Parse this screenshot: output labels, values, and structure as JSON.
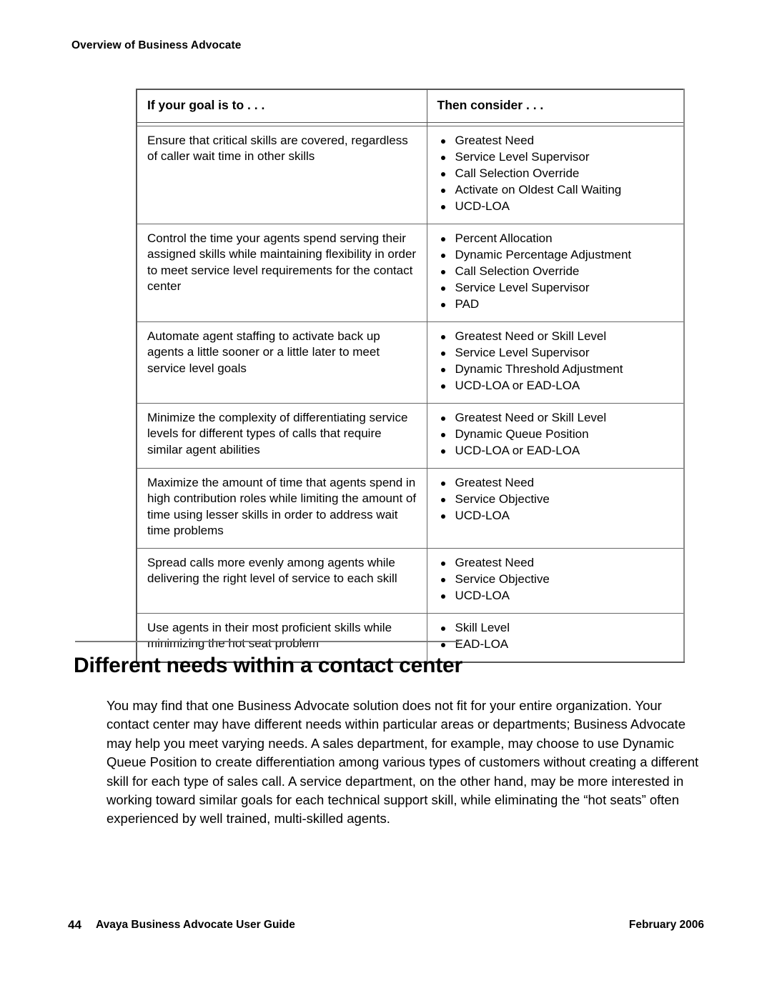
{
  "header": {
    "running_head": "Overview of Business Advocate"
  },
  "table": {
    "columns": [
      "If your goal is to . . .",
      "Then consider . . ."
    ],
    "rows": [
      {
        "goal": "Ensure that critical skills are covered, regardless of caller wait time in other skills",
        "consider": [
          "Greatest Need",
          "Service Level Supervisor",
          "Call Selection Override",
          "Activate on Oldest Call Waiting",
          "UCD-LOA"
        ]
      },
      {
        "goal": "Control the time your agents spend serving their assigned skills while maintaining flexibility in order to meet service level requirements for the contact center",
        "consider": [
          "Percent Allocation",
          "Dynamic Percentage Adjustment",
          "Call Selection Override",
          "Service Level Supervisor",
          "PAD"
        ]
      },
      {
        "goal": "Automate agent staffing to activate back up agents a little sooner or a little later to meet service level goals",
        "consider": [
          "Greatest Need or Skill Level",
          "Service Level Supervisor",
          "Dynamic Threshold Adjustment",
          "UCD-LOA or EAD-LOA"
        ]
      },
      {
        "goal": "Minimize the complexity of differentiating service levels for different types of calls that require similar agent abilities",
        "consider": [
          "Greatest Need or Skill Level",
          "Dynamic Queue Position",
          "UCD-LOA or EAD-LOA"
        ]
      },
      {
        "goal": "Maximize the amount of time that agents spend in high contribution roles while limiting the amount of time using lesser skills in order to address wait time problems",
        "consider": [
          "Greatest Need",
          "Service Objective",
          "UCD-LOA"
        ]
      },
      {
        "goal": "Spread calls more evenly among agents while delivering the right level of service to each skill",
        "consider": [
          "Greatest Need",
          "Service Objective",
          "UCD-LOA"
        ]
      },
      {
        "goal": "Use agents in their most proficient skills while minimizing the hot seat problem",
        "consider": [
          "Skill Level",
          "EAD-LOA"
        ]
      }
    ]
  },
  "section": {
    "heading": "Different needs within a contact center",
    "paragraph": "You may find that one Business Advocate solution does not fit for your entire organization. Your contact center may have different needs within particular areas or departments; Business Advocate may help you meet varying needs. A sales department, for example, may choose to use Dynamic Queue Position to create differentiation among various types of customers without creating a different skill for each type of sales call. A service department, on the other hand, may be more interested in working toward similar goals for each technical support skill, while eliminating the “hot seats” often experienced by well trained, multi-skilled agents."
  },
  "footer": {
    "page_number": "44",
    "document_title": "Avaya Business Advocate User Guide",
    "date": "February 2006"
  }
}
